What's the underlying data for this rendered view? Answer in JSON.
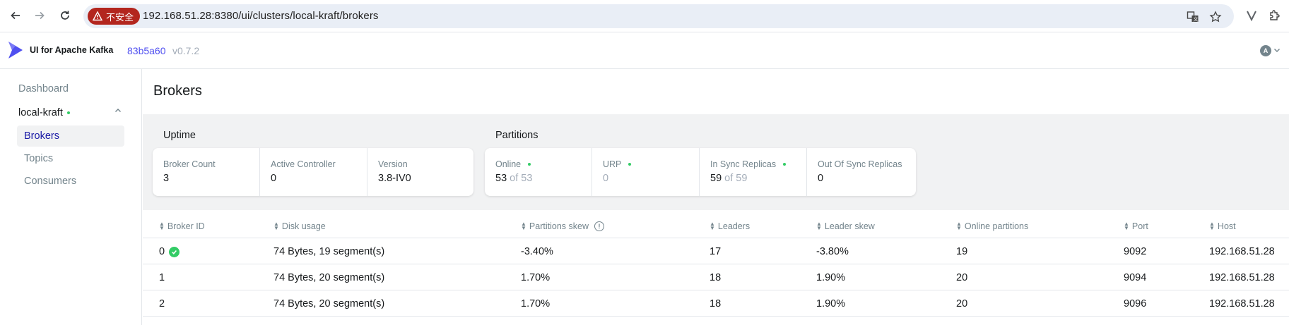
{
  "browser": {
    "insecure_label": "不安全",
    "url": "192.168.51.28:8380/ui/clusters/local-kraft/brokers"
  },
  "header": {
    "app_name": "UI for Apache Kafka",
    "version_hash": "83b5a60",
    "version": "v0.7.2",
    "user_initial": "A"
  },
  "sidebar": {
    "dashboard": "Dashboard",
    "cluster": "local-kraft",
    "items": [
      {
        "label": "Brokers",
        "active": true
      },
      {
        "label": "Topics",
        "active": false
      },
      {
        "label": "Consumers",
        "active": false
      }
    ]
  },
  "page": {
    "title": "Brokers"
  },
  "uptime": {
    "title": "Uptime",
    "broker_count_label": "Broker Count",
    "broker_count": "3",
    "active_controller_label": "Active Controller",
    "active_controller": "0",
    "version_label": "Version",
    "version": "3.8-IV0"
  },
  "partitions": {
    "title": "Partitions",
    "online_label": "Online",
    "online_value": "53",
    "online_of": "of 53",
    "urp_label": "URP",
    "urp_value": "0",
    "isr_label": "In Sync Replicas",
    "isr_value": "59",
    "isr_of": "of 59",
    "oosr_label": "Out Of Sync Replicas",
    "oosr_value": "0"
  },
  "table": {
    "headers": {
      "broker_id": "Broker ID",
      "disk_usage": "Disk usage",
      "partitions_skew": "Partitions skew",
      "leaders": "Leaders",
      "leader_skew": "Leader skew",
      "online_partitions": "Online partitions",
      "port": "Port",
      "host": "Host"
    },
    "rows": [
      {
        "broker_id": "0",
        "disk_usage": "74 Bytes, 19 segment(s)",
        "partitions_skew": "-3.40%",
        "leaders": "17",
        "leader_skew": "-3.80%",
        "online_partitions": "19",
        "port": "9092",
        "host": "192.168.51.28"
      },
      {
        "broker_id": "1",
        "disk_usage": "74 Bytes, 20 segment(s)",
        "partitions_skew": "1.70%",
        "leaders": "18",
        "leader_skew": "1.90%",
        "online_partitions": "20",
        "port": "9094",
        "host": "192.168.51.28"
      },
      {
        "broker_id": "2",
        "disk_usage": "74 Bytes, 20 segment(s)",
        "partitions_skew": "1.70%",
        "leaders": "18",
        "leader_skew": "1.90%",
        "online_partitions": "20",
        "port": "9096",
        "host": "192.168.51.28"
      }
    ]
  },
  "colors": {
    "accent": "#4f4ff0",
    "online_green": "#33cc66",
    "insecure_red": "#b3261e"
  }
}
